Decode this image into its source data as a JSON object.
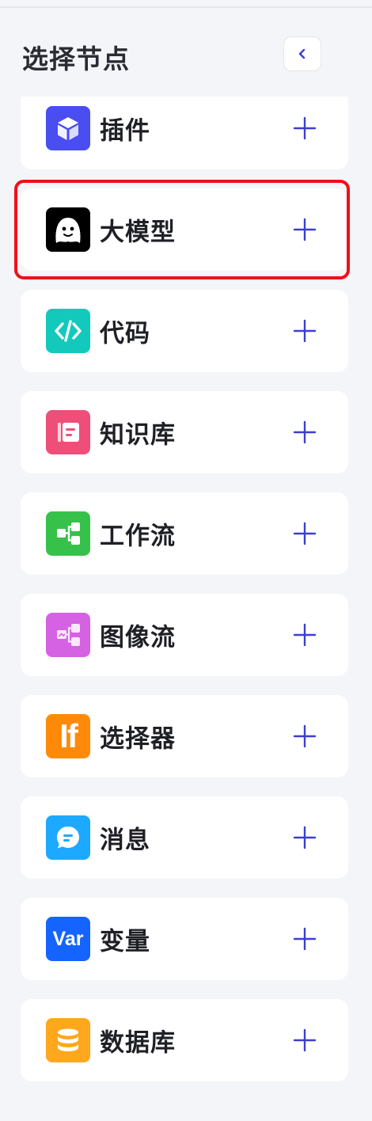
{
  "header": {
    "title": "选择节点"
  },
  "colors": {
    "accent": "#3b3fd1",
    "highlight_border": "#f01018"
  },
  "nodes": [
    {
      "label": "插件",
      "icon": "cube-icon",
      "color": "#4a4df0"
    },
    {
      "label": "大模型",
      "icon": "llm-face-icon",
      "color": "#000000"
    },
    {
      "label": "代码",
      "icon": "code-icon",
      "color": "#12c9bc"
    },
    {
      "label": "知识库",
      "icon": "knowledge-icon",
      "color": "#ee4f78"
    },
    {
      "label": "工作流",
      "icon": "workflow-icon",
      "color": "#36c24a"
    },
    {
      "label": "图像流",
      "icon": "imageflow-icon",
      "color": "#d561e3"
    },
    {
      "label": "选择器",
      "icon": "if-icon",
      "color": "#ff8a0a",
      "icon_text": "If"
    },
    {
      "label": "消息",
      "icon": "message-icon",
      "color": "#1ca9ff"
    },
    {
      "label": "变量",
      "icon": "var-icon",
      "color": "#1664ff",
      "icon_text": "Var"
    },
    {
      "label": "数据库",
      "icon": "database-icon",
      "color": "#ffa81d"
    }
  ]
}
